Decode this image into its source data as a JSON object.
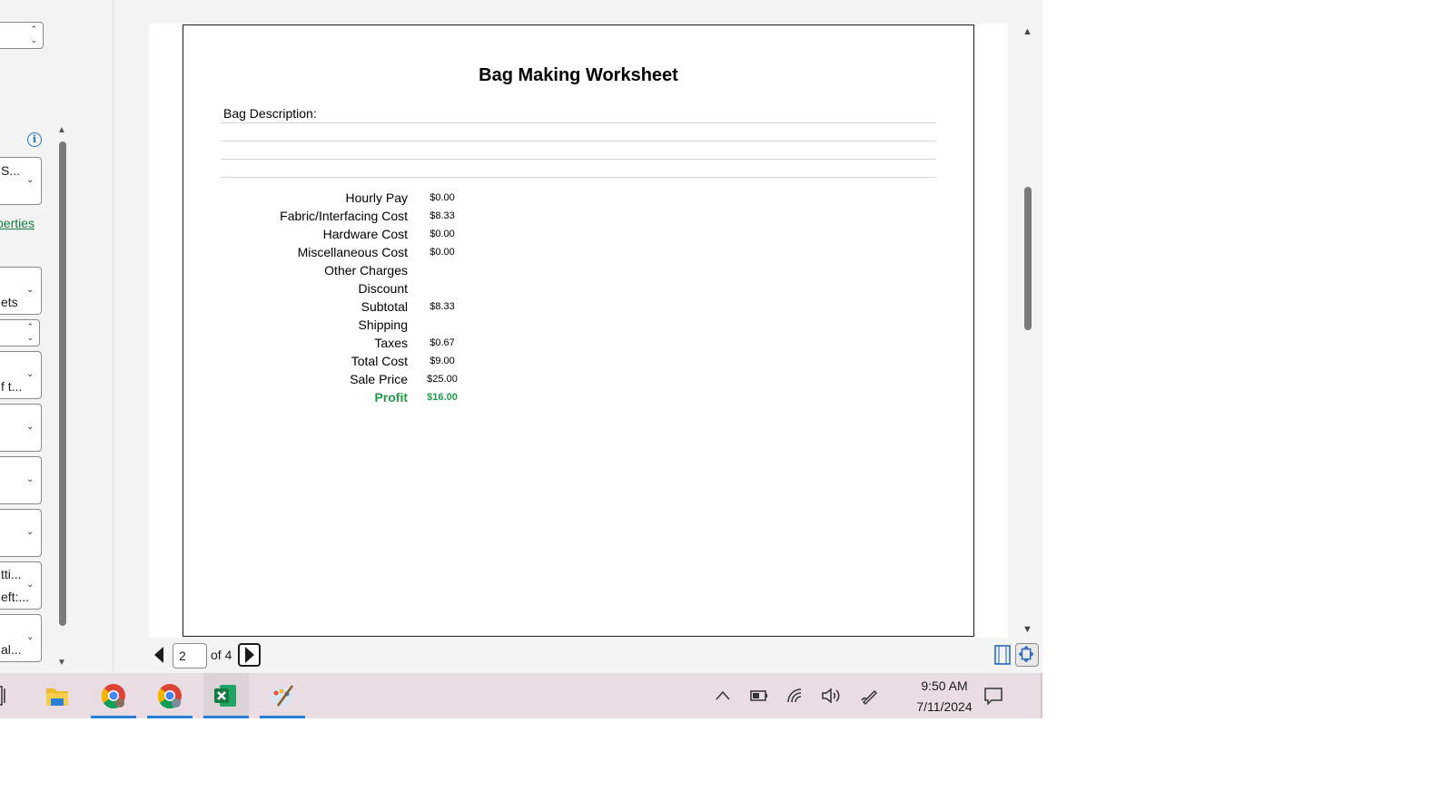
{
  "left_pane": {
    "controls": [
      {
        "text": "",
        "kind": "spinner"
      },
      {
        "text": "S...",
        "kind": "dropdown"
      },
      {
        "text": "ets",
        "kind": "dropdown"
      },
      {
        "text": "",
        "kind": "spinner"
      },
      {
        "text": "f t...",
        "kind": "dropdown"
      },
      {
        "text": "",
        "kind": "dropdown"
      },
      {
        "text": "",
        "kind": "dropdown"
      },
      {
        "text": "",
        "kind": "dropdown"
      },
      {
        "text": "tti...",
        "text2": "eft:...",
        "kind": "dropdown"
      },
      {
        "text": "al...",
        "kind": "dropdown"
      }
    ],
    "properties_link": "perties",
    "info_glyph": "i"
  },
  "worksheet": {
    "title": "Bag Making Worksheet",
    "description_label": "Bag Description:",
    "rows": [
      {
        "label": "Hourly Pay",
        "value": "$0.00"
      },
      {
        "label": "Fabric/Interfacing Cost",
        "value": "$8.33"
      },
      {
        "label": "Hardware Cost",
        "value": "$0.00"
      },
      {
        "label": "Miscellaneous Cost",
        "value": "$0.00"
      },
      {
        "label": "Other Charges",
        "value": ""
      },
      {
        "label": "Discount",
        "value": ""
      },
      {
        "label": "Subtotal",
        "value": "$8.33"
      },
      {
        "label": "Shipping",
        "value": ""
      },
      {
        "label": "Taxes",
        "value": "$0.67"
      },
      {
        "label": "Total Cost",
        "value": "$9.00"
      },
      {
        "label": "Sale Price",
        "value": "$25.00"
      },
      {
        "label": "Profit",
        "value": "$16.00"
      }
    ],
    "profit_color": "#1e9b48"
  },
  "navigation": {
    "current_page": "2",
    "of_label": "of 4"
  },
  "taskbar": {
    "apps": [
      {
        "name": "file-explorer",
        "active": false
      },
      {
        "name": "chrome",
        "active": true
      },
      {
        "name": "chrome",
        "active": true
      },
      {
        "name": "excel",
        "active": true
      },
      {
        "name": "paint",
        "active": true
      }
    ],
    "time": "9:50 AM",
    "date": "7/11/2024"
  },
  "colors": {
    "accent": "#2a7ed6",
    "excel_green": "#107c41",
    "taskbar_bg": "#e9dde3"
  }
}
